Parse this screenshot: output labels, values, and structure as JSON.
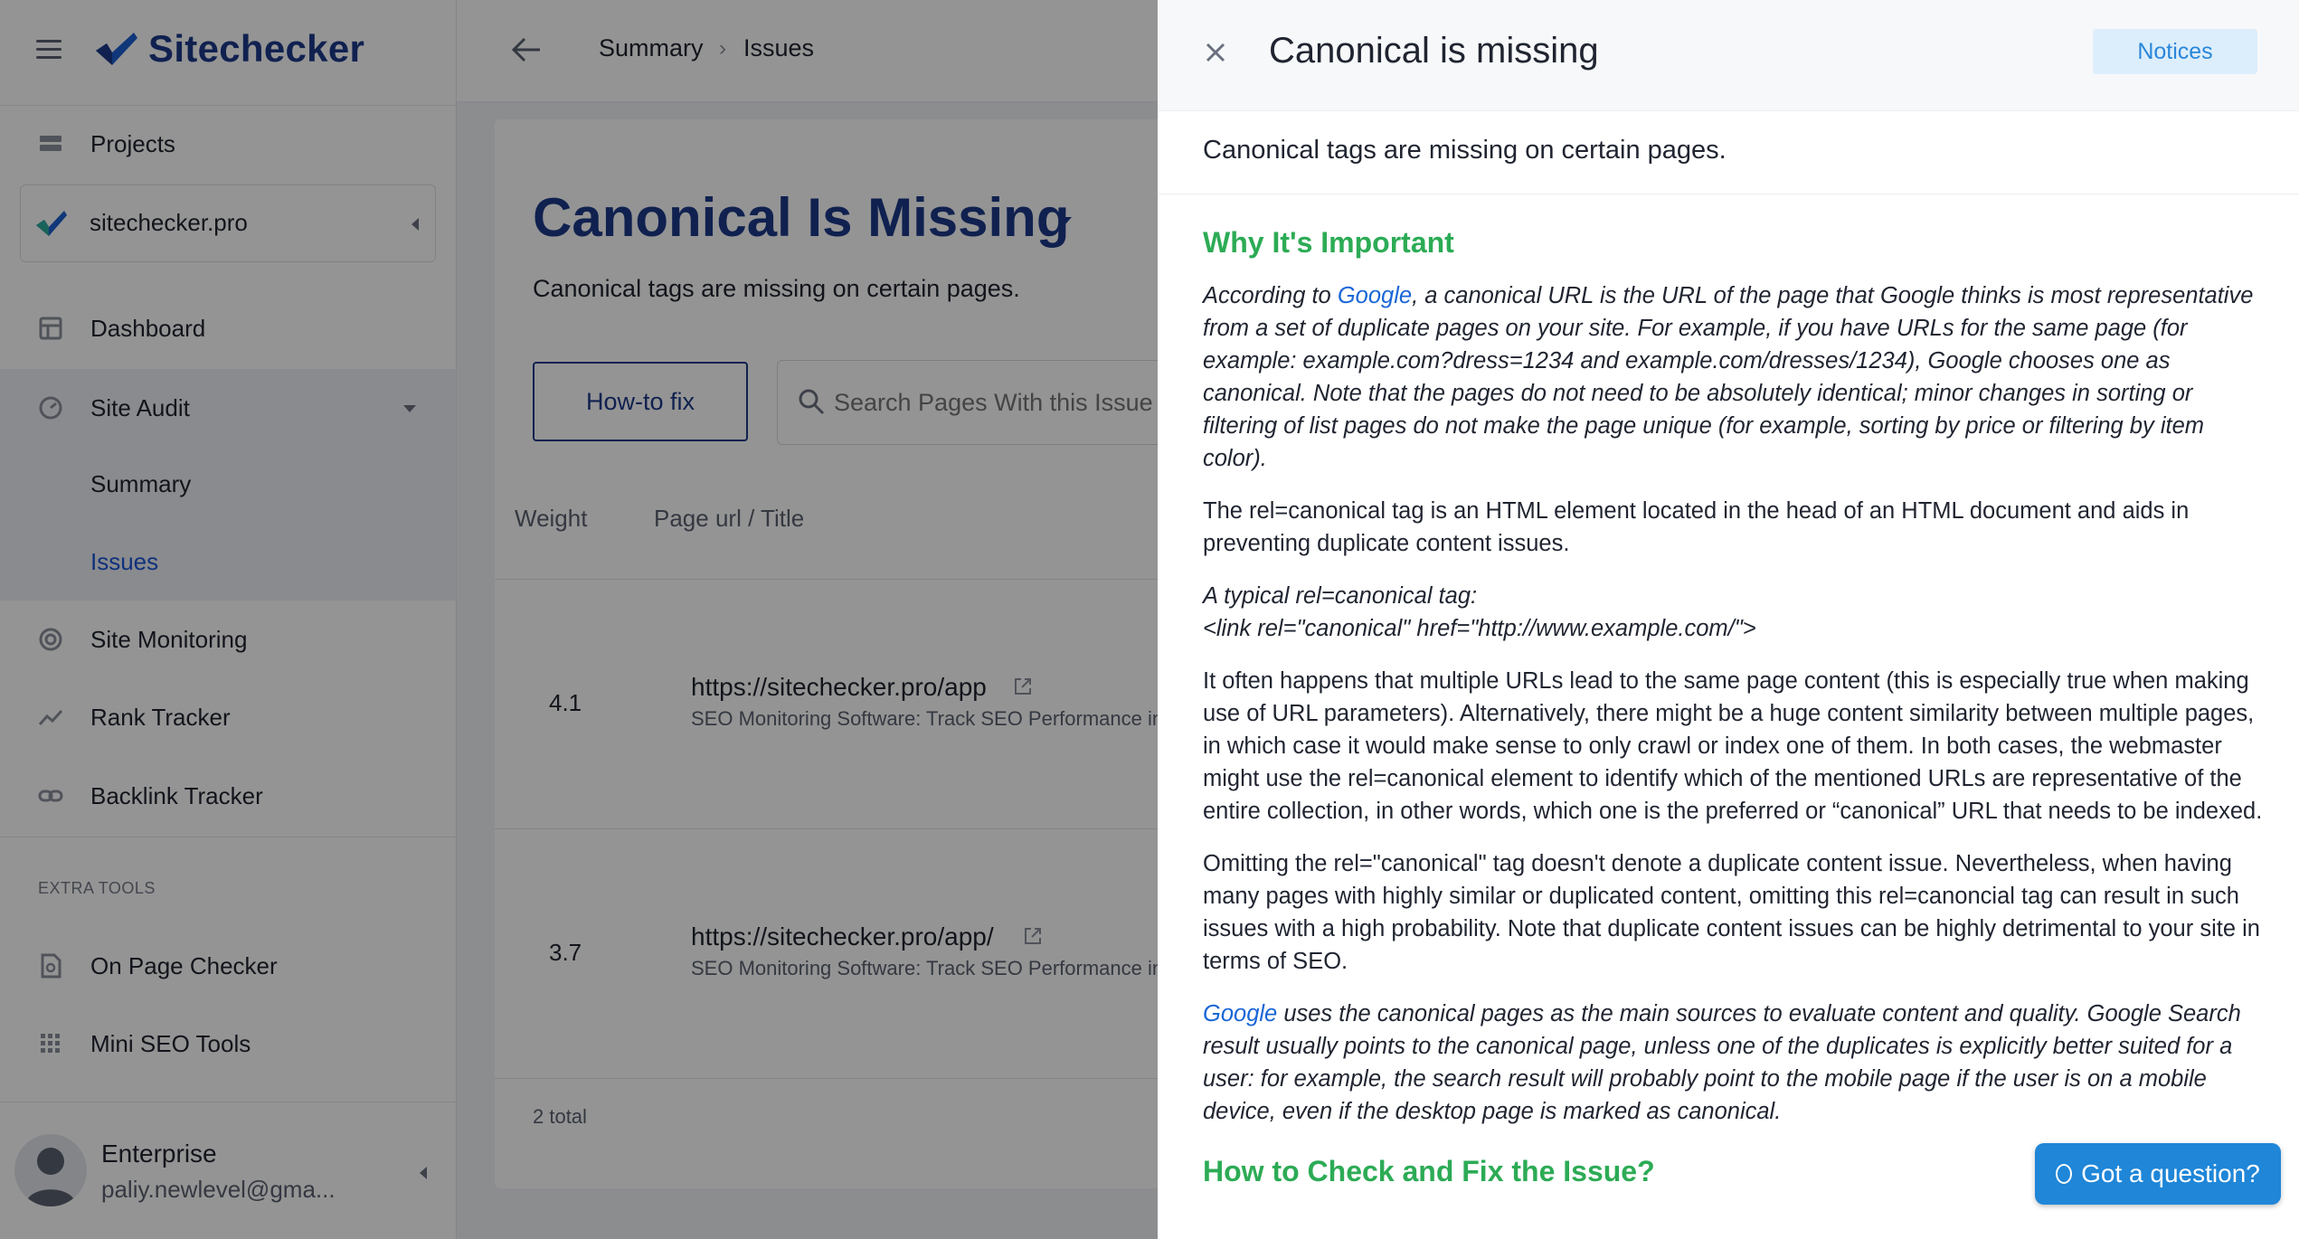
{
  "app": {
    "brand": "Sitechecker",
    "accent": "#1d3a8a",
    "green": "#2cab55",
    "link": "#1a66d6"
  },
  "sidebar": {
    "projects_label": "Projects",
    "project_name": "sitechecker.pro",
    "items": [
      {
        "label": "Dashboard",
        "icon": "dashboard-icon"
      },
      {
        "label": "Site Audit",
        "icon": "gauge-icon"
      },
      {
        "label": "Site Monitoring",
        "icon": "monitoring-icon"
      },
      {
        "label": "Rank Tracker",
        "icon": "trend-icon"
      },
      {
        "label": "Backlink Tracker",
        "icon": "link-icon"
      }
    ],
    "site_audit_sub": {
      "summary": "Summary",
      "issues": "Issues"
    },
    "extra_tools_caption": "EXTRA TOOLS",
    "extra_tools": [
      {
        "label": "On Page Checker",
        "icon": "document-search-icon"
      },
      {
        "label": "Mini SEO Tools",
        "icon": "grid-icon"
      }
    ],
    "user": {
      "plan": "Enterprise",
      "email": "paliy.newlevel@gma..."
    }
  },
  "header": {
    "breadcrumb": [
      "Summary",
      "Issues"
    ]
  },
  "main": {
    "title": "Canonical Is Missing",
    "description": "Canonical tags are missing on certain pages.",
    "how_to_fix": "How-to fix",
    "search_placeholder": "Search Pages With this Issue",
    "columns": {
      "weight": "Weight",
      "page": "Page url / Title"
    },
    "rows": [
      {
        "weight": "4.1",
        "url": "https://sitechecker.pro/app",
        "title": "SEO Monitoring Software: Track SEO Performance in"
      },
      {
        "weight": "3.7",
        "url": "https://sitechecker.pro/app/",
        "title": "SEO Monitoring Software: Track SEO Performance in"
      }
    ],
    "total": "2 total"
  },
  "drawer": {
    "title": "Canonical is missing",
    "badge": "Notices",
    "subtitle": "Canonical tags are missing on certain pages.",
    "h_why": "Why It's Important",
    "p1_link": "Google",
    "p1_rest": ", a canonical URL is the URL of the page that Google thinks is most representative from a set of duplicate pages on your site. For example, if you have URLs for the same page (for example: example.com?dress=1234 and example.com/dresses/1234), Google chooses one as canonical. Note that the pages do not need to be absolutely identical; minor changes in sorting or filtering of list pages do not make the page unique (for example, sorting by price or filtering by item color).",
    "p1_lead": "According to ",
    "p2": "The rel=canonical tag is an HTML element located in the head of an HTML document and aids in preventing duplicate content issues.",
    "p3_line1": "A typical rel=canonical tag:",
    "p3_line2": "<link rel=\"canonical\" href=\"http://www.example.com/\">",
    "p4": "It often happens that multiple URLs lead to the same page content (this is especially true when making use of URL parameters). Alternatively, there might be a huge content similarity between multiple pages, in which case it would make sense to only crawl or index one of them. In both cases, the webmaster might use the rel=canonical element to identify which of the mentioned URLs are representative of the entire collection, in other words, which one is the preferred or “canonical” URL that needs to be indexed.",
    "p5": "Omitting the rel=\"canonical\" tag doesn't denote a duplicate content issue. Nevertheless, when having many pages with highly similar or duplicated content, omitting this rel=canoncial tag can result in such issues with a high probability. Note that duplicate content issues can be highly detrimental to your site in terms of SEO.",
    "p6_link": "Google",
    "p6_rest": " uses the canonical pages as the main sources to evaluate content and quality. Google Search result usually points to the canonical page, unless one of the duplicates is explicitly better suited for a user: for example, the search result will probably point to the mobile page if the user is on a mobile device, even if the desktop page is marked as canonical.",
    "h_fix": "How to Check and Fix the Issue?"
  },
  "chat": {
    "label": "Got a question?"
  }
}
